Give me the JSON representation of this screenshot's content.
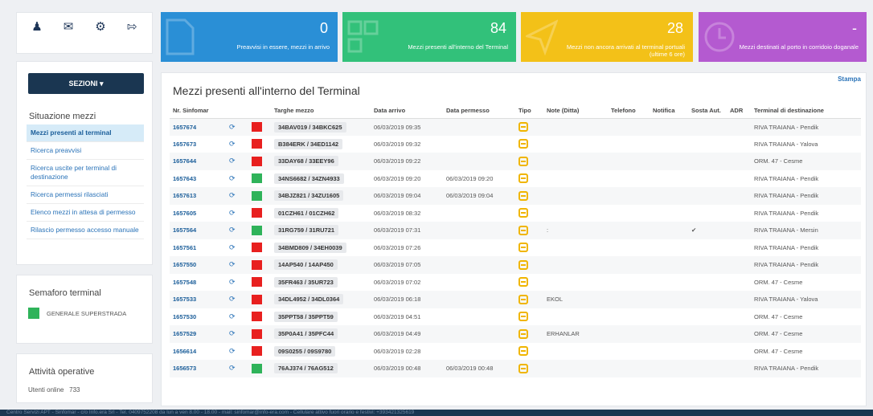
{
  "colors": {
    "tile_blue": "#2a8fd6",
    "tile_green": "#32c17a",
    "tile_yellow": "#f3c118",
    "tile_purple": "#b45ad0",
    "nav_dark": "#1a3651",
    "red": "#e8201f",
    "green": "#2fb35a"
  },
  "top_icons": [
    "user-icon",
    "mail-icon",
    "gear-icon",
    "logout-icon"
  ],
  "sidebar": {
    "sezioni_label": "SEZIONI ▾",
    "situazione_title": "Situazione mezzi",
    "items": [
      {
        "label": "Mezzi presenti al terminal",
        "active": true
      },
      {
        "label": "Ricerca preavvisi"
      },
      {
        "label": "Ricerca uscite per terminal di destinazione"
      },
      {
        "label": "Ricerca permessi rilasciati"
      },
      {
        "label": "Elenco mezzi in attesa di permesso"
      },
      {
        "label": "Rilascio permesso accesso manuale"
      }
    ],
    "semaforo_title": "Semaforo terminal",
    "semaforo_item": "GENERALE SUPERSTRADA",
    "attivita_title": "Attività operative",
    "utenti_label": "Utenti online",
    "utenti_value": "733"
  },
  "tiles": [
    {
      "num": "0",
      "label": "Preavvisi in essere, mezzi in arrivo",
      "color": "blue"
    },
    {
      "num": "84",
      "label": "Mezzi presenti all'interno del Terminal",
      "color": "green"
    },
    {
      "num": "28",
      "label": "Mezzi non ancora arrivati al terminal portuali",
      "label2": "(ultime 6 ore)",
      "color": "yellow"
    },
    {
      "num": "-",
      "label": "Mezzi destinati al porto in corridoio doganale",
      "color": "purple"
    }
  ],
  "main": {
    "title": "Mezzi presenti all'interno del Terminal",
    "stampa": "Stampa",
    "columns": [
      "Nr. Sinfomar",
      "",
      "",
      "Targhe mezzo",
      "Data arrivo",
      "Data permesso",
      "Tipo",
      "Note (Ditta)",
      "Telefono",
      "Notifica",
      "Sosta Aut.",
      "ADR",
      "Terminal di destinazione"
    ],
    "rows": [
      {
        "nr": "1657674",
        "status": "red",
        "targhe": "34BAV019 / 34BKC625",
        "arrivo": "06/03/2019 09:35",
        "permesso": "",
        "note": "",
        "sosta": "",
        "dest": "RIVA TRAIANA - Pendik"
      },
      {
        "nr": "1657673",
        "status": "red",
        "targhe": "B384ERK / 34ED1142",
        "arrivo": "06/03/2019 09:32",
        "permesso": "",
        "note": "",
        "sosta": "",
        "dest": "RIVA TRAIANA - Yalova"
      },
      {
        "nr": "1657644",
        "status": "red",
        "targhe": "33DAY68 / 33EEY96",
        "arrivo": "06/03/2019 09:22",
        "permesso": "",
        "note": "",
        "sosta": "",
        "dest": "ORM. 47 - Cesme"
      },
      {
        "nr": "1657643",
        "status": "green",
        "targhe": "34NS6682 / 34ZN4933",
        "arrivo": "06/03/2019 09:20",
        "permesso": "06/03/2019 09:20",
        "note": "",
        "sosta": "",
        "dest": "RIVA TRAIANA - Pendik"
      },
      {
        "nr": "1657613",
        "status": "green",
        "targhe": "34BJZ821 / 34ZU1605",
        "arrivo": "06/03/2019 09:04",
        "permesso": "06/03/2019 09:04",
        "note": "",
        "sosta": "",
        "dest": "RIVA TRAIANA - Pendik"
      },
      {
        "nr": "1657605",
        "status": "red",
        "targhe": "01CZH61 / 01CZH62",
        "arrivo": "06/03/2019 08:32",
        "permesso": "",
        "note": "",
        "sosta": "",
        "dest": "RIVA TRAIANA - Pendik"
      },
      {
        "nr": "1657564",
        "status": "green",
        "targhe": "31RG759 / 31RU721",
        "arrivo": "06/03/2019 07:31",
        "permesso": "",
        "note": ":",
        "sosta": "✔",
        "dest": "RIVA TRAIANA - Mersin"
      },
      {
        "nr": "1657561",
        "status": "red",
        "targhe": "34BMD809 / 34EH0039",
        "arrivo": "06/03/2019 07:26",
        "permesso": "",
        "note": "",
        "sosta": "",
        "dest": "RIVA TRAIANA - Pendik"
      },
      {
        "nr": "1657550",
        "status": "red",
        "targhe": "14AP540 / 14AP450",
        "arrivo": "06/03/2019 07:05",
        "permesso": "",
        "note": "",
        "sosta": "",
        "dest": "RIVA TRAIANA - Pendik"
      },
      {
        "nr": "1657548",
        "status": "red",
        "targhe": "35FR463 / 35UR723",
        "arrivo": "06/03/2019 07:02",
        "permesso": "",
        "note": "",
        "sosta": "",
        "dest": "ORM. 47 - Cesme"
      },
      {
        "nr": "1657533",
        "status": "red",
        "targhe": "34DL4952 / 34DL0364",
        "arrivo": "06/03/2019 06:18",
        "permesso": "",
        "note": "EKOL",
        "sosta": "",
        "dest": "RIVA TRAIANA - Yalova"
      },
      {
        "nr": "1657530",
        "status": "red",
        "targhe": "35PPT58 / 35PPT59",
        "arrivo": "06/03/2019 04:51",
        "permesso": "",
        "note": "",
        "sosta": "",
        "dest": "ORM. 47 - Cesme"
      },
      {
        "nr": "1657529",
        "status": "red",
        "targhe": "35P0A41 / 35PFC44",
        "arrivo": "06/03/2019 04:49",
        "permesso": "",
        "note": "ERHANLAR",
        "sosta": "",
        "dest": "ORM. 47 - Cesme"
      },
      {
        "nr": "1656614",
        "status": "red",
        "targhe": "09S0255 / 09S9780",
        "arrivo": "06/03/2019 02:28",
        "permesso": "",
        "note": "",
        "sosta": "",
        "dest": "ORM. 47 - Cesme"
      },
      {
        "nr": "1656573",
        "status": "green",
        "targhe": "76AJ374 / 76AG512",
        "arrivo": "06/03/2019 00:48",
        "permesso": "06/03/2019 00:48",
        "note": "",
        "sosta": "",
        "dest": "RIVA TRAIANA - Pendik"
      }
    ]
  },
  "footer": "Centro Servizi APT - Sinfomar - c/o Info.era Srl - Tel. 0409752208 da lun a ven 8.00 - 18.00 - mail: sinfomar@info-era.com - Cellulare attivo fuori orario e festivi: +393421325619"
}
